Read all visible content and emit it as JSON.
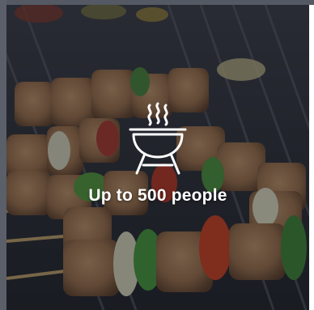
{
  "card": {
    "caption": "Up to 500 people",
    "icon": "bbq-grill-icon",
    "image": "grilled-skewers-photo"
  },
  "colors": {
    "overlay": "#14161e",
    "text": "#ffffff",
    "frame": "#5a5f6a"
  }
}
